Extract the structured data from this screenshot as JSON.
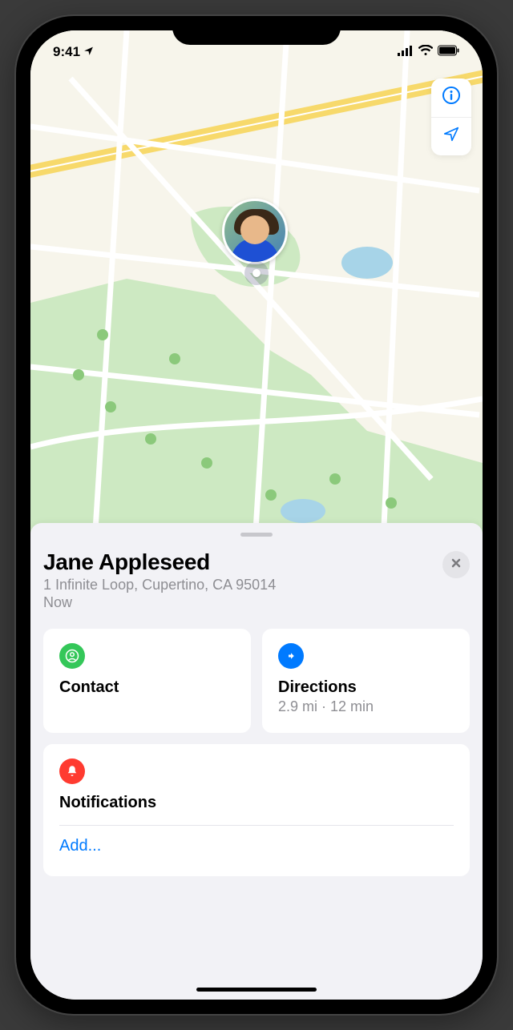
{
  "status_bar": {
    "time": "9:41",
    "location_arrow": "▸"
  },
  "map": {
    "controls": {
      "info_icon": "info-icon",
      "locate_icon": "location-arrow-icon"
    },
    "pin": {
      "person": "jane-avatar"
    }
  },
  "sheet": {
    "name": "Jane Appleseed",
    "address": "1 Infinite Loop, Cupertino, CA 95014",
    "time": "Now",
    "close_label": "✕",
    "actions": {
      "contact": {
        "title": "Contact"
      },
      "directions": {
        "title": "Directions",
        "subtitle": "2.9 mi · 12 min"
      }
    },
    "notifications": {
      "title": "Notifications",
      "add": "Add..."
    }
  }
}
